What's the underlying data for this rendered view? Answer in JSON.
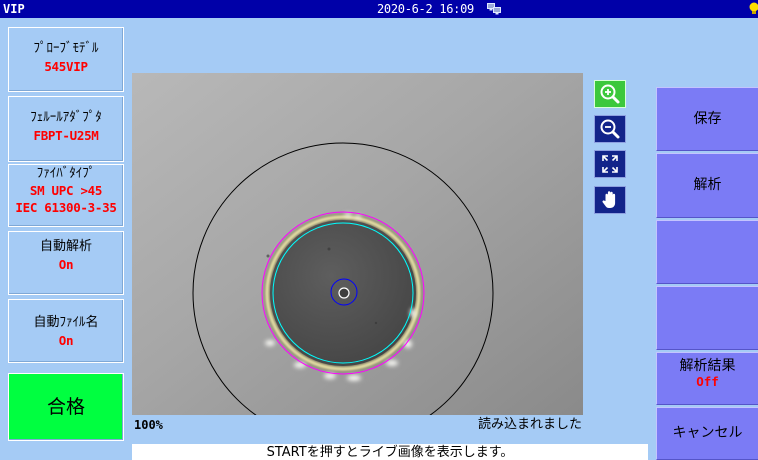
{
  "status_bar": {
    "app_name": "VIP",
    "datetime": "2020-6-2 16:09",
    "network_icon": "network-icon",
    "right_icon": "bulb-icon"
  },
  "left_panel": {
    "probe_model": {
      "label": "ﾌﾟﾛｰﾌﾞﾓﾃﾞﾙ",
      "value": "545VIP"
    },
    "ferrule_adapter": {
      "label": "ﾌｪﾙｰﾙｱﾀﾞﾌﾟﾀ",
      "value": "FBPT-U25M"
    },
    "fiber_type": {
      "label": "ﾌｧｲﾊﾞﾀｲﾌﾟ",
      "values": [
        "SM UPC >45",
        "IEC 61300-3-35"
      ]
    },
    "auto_analysis": {
      "label": "自動解析",
      "value": "On"
    },
    "auto_filename": {
      "label": "自動ﾌｧｲﾙ名",
      "value": "On"
    },
    "result": {
      "label": "合格"
    }
  },
  "viewer": {
    "zoom_level": "100%",
    "status": "読み込まれました",
    "hint": "STARTを押すとライブ画像を表示します。"
  },
  "tools": [
    {
      "icon": "zoom-in-icon",
      "active": true
    },
    {
      "icon": "zoom-out-icon",
      "active": false
    },
    {
      "icon": "fit-to-screen-icon",
      "active": false
    },
    {
      "icon": "pan-hand-icon",
      "active": false
    }
  ],
  "right_panel": {
    "save_label": "保存",
    "analyze_label": "解析",
    "analysis_result": {
      "label": "解析結果",
      "value": "Off"
    },
    "cancel_label": "キャンセル"
  },
  "colors": {
    "status_bar": "#0000A8",
    "background": "#A5CBF5",
    "value_text": "#FF0000",
    "pass": "#00FF40",
    "right_button": "#7B7BF5",
    "overlay_outer": "#000000",
    "overlay_cladding": "#FF00FF",
    "overlay_core_zone": "#00FFFF",
    "overlay_core": "#0000FF"
  }
}
